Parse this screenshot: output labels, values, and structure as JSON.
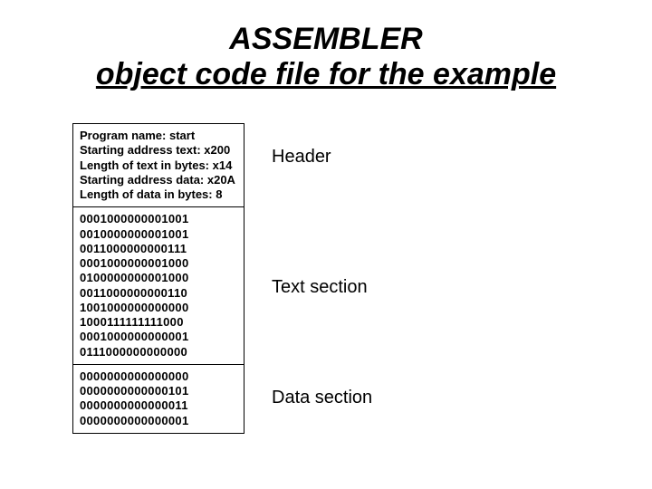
{
  "title": {
    "line1": "ASSEMBLER",
    "line2": "object code file for the example"
  },
  "header": {
    "lines": [
      "Program name: start",
      "Starting address text: x200",
      "Length of text in bytes: x14",
      "Starting address data: x20A",
      "Length of data in bytes: 8"
    ]
  },
  "text_section": {
    "rows": [
      "0001000000001001",
      "0010000000001001",
      "0011000000000111",
      "0001000000001000",
      "0100000000001000",
      "0011000000000110",
      "1001000000000000",
      "1000111111111000",
      "0001000000000001",
      "0111000000000000"
    ]
  },
  "data_section": {
    "rows": [
      "0000000000000000",
      "0000000000000101",
      "0000000000000011",
      "0000000000000001"
    ]
  },
  "labels": {
    "header": "Header",
    "text": "Text section",
    "data": "Data section"
  }
}
